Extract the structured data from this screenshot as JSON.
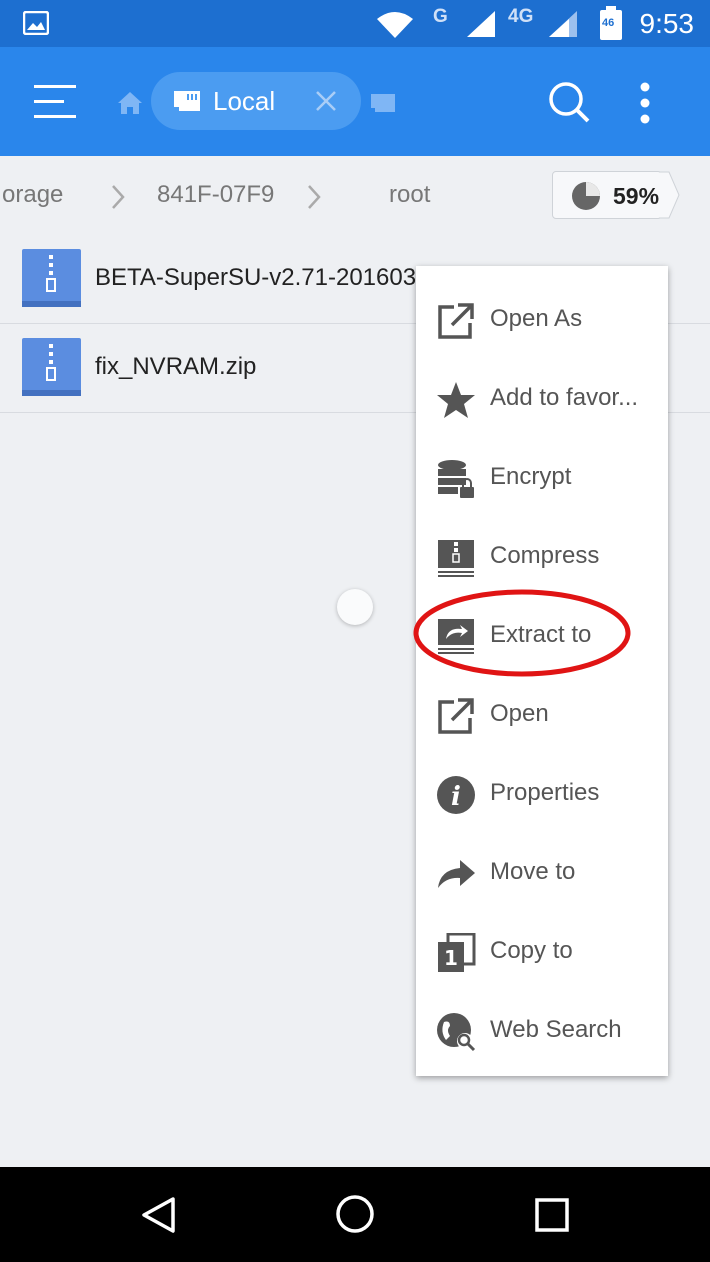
{
  "status_bar": {
    "time": "9:53",
    "network_g": "G",
    "network_4g": "4G",
    "battery_label": "46"
  },
  "toolbar": {
    "tab_label": "Local"
  },
  "breadcrumb": {
    "items": [
      "orage",
      "841F-07F9",
      "root"
    ],
    "storage_percent": "59%"
  },
  "files": [
    {
      "name": "BETA-SuperSU-v2.71-201603"
    },
    {
      "name": "fix_NVRAM.zip"
    }
  ],
  "context_menu": {
    "items": [
      {
        "label": "Open As",
        "icon": "open-external-icon"
      },
      {
        "label": "Add to favor...",
        "icon": "star-icon"
      },
      {
        "label": "Encrypt",
        "icon": "encrypt-icon"
      },
      {
        "label": "Compress",
        "icon": "compress-icon"
      },
      {
        "label": "Extract to",
        "icon": "extract-icon"
      },
      {
        "label": "Open",
        "icon": "open-external-icon"
      },
      {
        "label": "Properties",
        "icon": "info-icon"
      },
      {
        "label": "Move to",
        "icon": "move-arrow-icon"
      },
      {
        "label": "Copy to",
        "icon": "copy-icon"
      },
      {
        "label": "Web Search",
        "icon": "web-search-icon"
      }
    ],
    "highlighted_item": "Extract to",
    "highlight_color": "#e01414"
  },
  "colors": {
    "status_bar": "#1d6fd0",
    "app_bar": "#2a86eb",
    "zip_icon": "#5b8de0"
  }
}
